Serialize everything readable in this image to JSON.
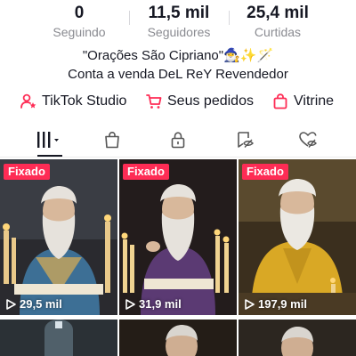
{
  "stats": [
    {
      "value": "0",
      "label": "Seguindo"
    },
    {
      "value": "11,5 mil",
      "label": "Seguidores"
    },
    {
      "value": "25,4 mil",
      "label": "Curtidas"
    }
  ],
  "bio": {
    "line1": "\"Orações São Cipriano\"🧙‍♂️✨🪄",
    "line2": "Conta a venda DeL ReY Revendedor"
  },
  "links": [
    {
      "label": "TikTok Studio",
      "icon": "person-star-icon"
    },
    {
      "label": "Seus pedidos",
      "icon": "cart-icon"
    },
    {
      "label": "Vitrine",
      "icon": "shopping-bag-icon"
    }
  ],
  "tabs": [
    {
      "icon": "grid-icon",
      "selected": true
    },
    {
      "icon": "shop-bag-icon"
    },
    {
      "icon": "lock-icon"
    },
    {
      "icon": "bookmark-eye-icon"
    },
    {
      "icon": "heart-eye-icon"
    }
  ],
  "videos": [
    {
      "badge": "Fixado",
      "views": "29,5 mil"
    },
    {
      "badge": "Fixado",
      "views": "31,9 mil"
    },
    {
      "badge": "Fixado",
      "views": "197,9 mil"
    }
  ],
  "colors": {
    "badge": "#fe2c55",
    "accent_icon": "#fe2c55",
    "text": "#161823",
    "muted": "#8a8b91"
  }
}
